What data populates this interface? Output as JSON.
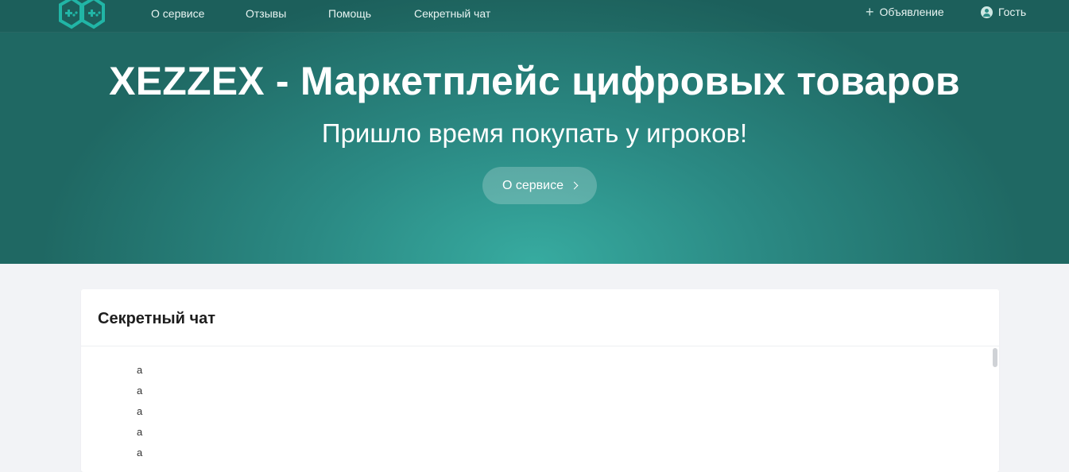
{
  "navbar": {
    "logo": "gamepad-hex-logo",
    "links": [
      {
        "label": "О сервисе"
      },
      {
        "label": "Отзывы"
      },
      {
        "label": "Помощь"
      },
      {
        "label": "Секретный чат"
      }
    ],
    "add_listing": {
      "icon": "plus-icon",
      "label": "Объявление"
    },
    "user": {
      "icon": "user-circle-icon",
      "label": "Гость"
    }
  },
  "hero": {
    "title": "XEZZEX - Маркетплейс цифровых товаров",
    "subtitle": "Пришло время покупать у игроков!",
    "button": {
      "label": "О сервисе",
      "icon": "chevron-right-icon"
    }
  },
  "chat": {
    "title": "Секретный чат",
    "messages": [
      "a",
      "a",
      "a",
      "a",
      "a"
    ]
  },
  "colors": {
    "hero_bg": "#2b8a84",
    "hero_center": "#37aba0",
    "page_bg": "#f2f3f6",
    "logo_accent": "#21b5a6"
  }
}
